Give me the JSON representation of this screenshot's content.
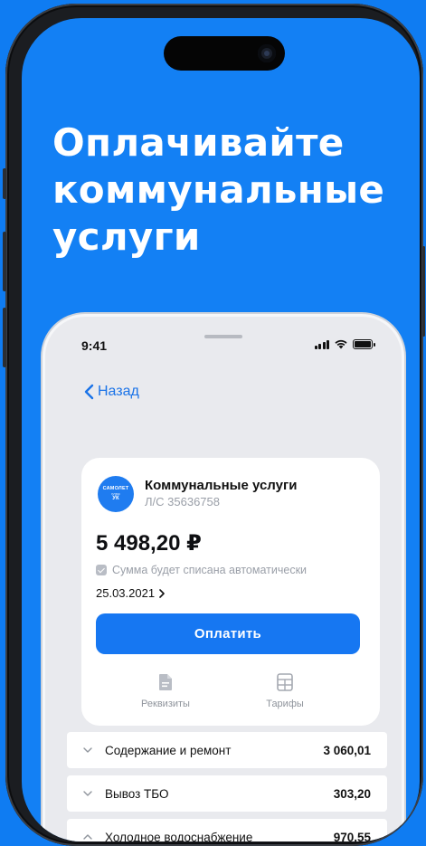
{
  "headline": {
    "line1": "Оплачивайте",
    "line2": "коммунальные",
    "line3": "услуги"
  },
  "status_bar": {
    "time": "9:41"
  },
  "nav": {
    "back_label": "Назад"
  },
  "bill_card": {
    "logo": {
      "brand": "САМОЛЕТ",
      "sub": "плюс",
      "abbr": "УК"
    },
    "title": "Коммунальные услуги",
    "account": "Л/С 35636758",
    "amount": "5 498,20 ₽",
    "autopay_text": "Сумма будет списана автоматически",
    "due_date": "25.03.2021",
    "pay_label": "Оплатить",
    "actions": [
      {
        "label": "Реквизиты",
        "icon": "document-icon"
      },
      {
        "label": "Тарифы",
        "icon": "calculator-icon"
      }
    ]
  },
  "charges": [
    {
      "label": "Содержание и ремонт",
      "value": "3 060,01",
      "expanded": false
    },
    {
      "label": "Вывоз ТБО",
      "value": "303,20",
      "expanded": false
    },
    {
      "label": "Холодное водоснабжение",
      "value": "970,55",
      "expanded": true
    }
  ],
  "colors": {
    "background": "#0f7cf2",
    "accent": "#1677f2",
    "link": "#1a73e8"
  }
}
